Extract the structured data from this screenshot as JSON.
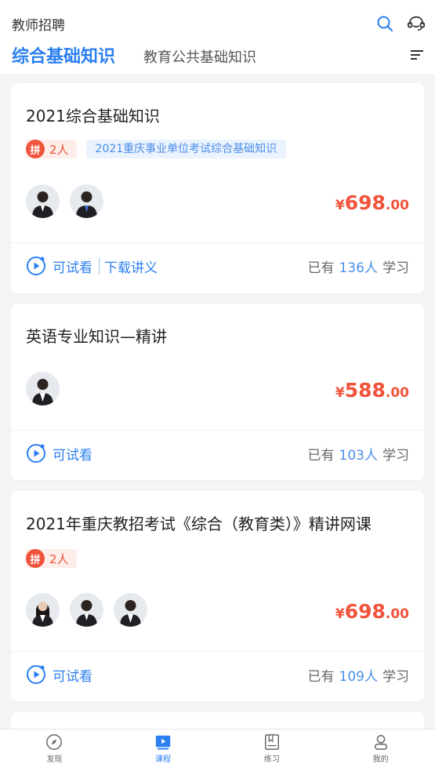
{
  "header": {
    "app_title": "教师招聘",
    "tabs": [
      {
        "label": "综合基础知识",
        "active": true
      },
      {
        "label": "教育公共基础知识",
        "active": false
      }
    ]
  },
  "courses": [
    {
      "title": "2021综合基础知识",
      "group_count": "2人",
      "group_icon": "拼",
      "exam_tag": "2021重庆事业单位考试综合基础知识",
      "avatar_count": 2,
      "price_symbol": "¥",
      "price_int": "698",
      "price_dec": ".00",
      "trial_label": "可试看",
      "download_label": "下载讲义",
      "learners_prefix": "已有",
      "learners_count": "136人",
      "learners_suffix": "学习"
    },
    {
      "title": "英语专业知识—精讲",
      "avatar_count": 1,
      "price_symbol": "¥",
      "price_int": "588",
      "price_dec": ".00",
      "trial_label": "可试看",
      "learners_prefix": "已有",
      "learners_count": "103人",
      "learners_suffix": "学习"
    },
    {
      "title": "2021年重庆教招考试《综合（教育类）》精讲网课",
      "group_count": "2人",
      "group_icon": "拼",
      "avatar_count": 3,
      "price_symbol": "¥",
      "price_int": "698",
      "price_dec": ".00",
      "trial_label": "可试看",
      "learners_prefix": "已有",
      "learners_count": "109人",
      "learners_suffix": "学习"
    }
  ],
  "bottom_nav": [
    {
      "label": "发现",
      "icon": "compass-icon",
      "active": false
    },
    {
      "label": "课程",
      "icon": "play-video-icon",
      "active": true
    },
    {
      "label": "练习",
      "icon": "book-icon",
      "active": false
    },
    {
      "label": "我的",
      "icon": "user-icon",
      "active": false
    }
  ],
  "colors": {
    "accent": "#2b7ff0",
    "price": "#f0533b",
    "tag_bg": "#eaf3fe"
  }
}
